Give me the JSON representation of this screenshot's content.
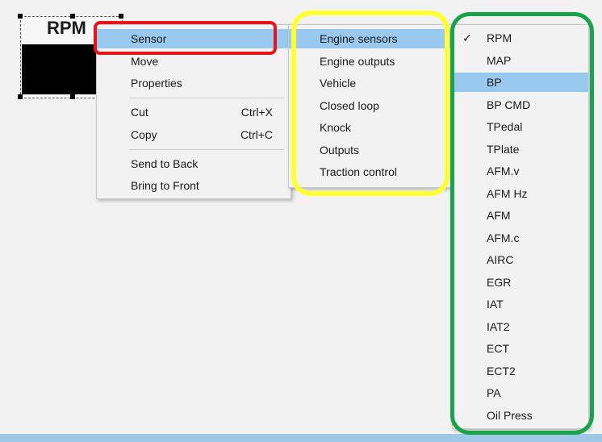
{
  "gauge": {
    "title": "RPM"
  },
  "context_menu": {
    "items": [
      {
        "label": "Sensor",
        "shortcut": "",
        "submenu": true,
        "highlighted": true
      },
      {
        "label": "Move",
        "shortcut": "",
        "submenu": false
      },
      {
        "label": "Properties",
        "shortcut": "",
        "submenu": false
      },
      {
        "label": "Cut",
        "shortcut": "Ctrl+X",
        "submenu": false
      },
      {
        "label": "Copy",
        "shortcut": "Ctrl+C",
        "submenu": false
      },
      {
        "label": "Send to Back",
        "shortcut": "",
        "submenu": false
      },
      {
        "label": "Bring to Front",
        "shortcut": "",
        "submenu": false
      }
    ]
  },
  "sensor_submenu": {
    "items": [
      {
        "label": "Engine sensors",
        "highlighted": true
      },
      {
        "label": "Engine outputs"
      },
      {
        "label": "Vehicle"
      },
      {
        "label": "Closed loop"
      },
      {
        "label": "Knock"
      },
      {
        "label": "Outputs"
      },
      {
        "label": "Traction control"
      }
    ]
  },
  "engine_sensors_submenu": {
    "items": [
      {
        "label": "RPM",
        "checked": true
      },
      {
        "label": "MAP"
      },
      {
        "label": "BP",
        "highlighted": true
      },
      {
        "label": "BP CMD"
      },
      {
        "label": "TPedal"
      },
      {
        "label": "TPlate"
      },
      {
        "label": "AFM.v"
      },
      {
        "label": "AFM Hz"
      },
      {
        "label": "AFM"
      },
      {
        "label": "AFM.c"
      },
      {
        "label": "AIRC"
      },
      {
        "label": "EGR"
      },
      {
        "label": "IAT"
      },
      {
        "label": "IAT2"
      },
      {
        "label": "ECT"
      },
      {
        "label": "ECT2"
      },
      {
        "label": "PA"
      },
      {
        "label": "Oil Press"
      }
    ]
  },
  "annotation_colors": {
    "red": "#e8131b",
    "yellow": "#ffff33",
    "green": "#1aa34a"
  },
  "icons": {
    "submenu_arrow": "chevron-right-icon",
    "checkmark": "checkmark-icon"
  }
}
